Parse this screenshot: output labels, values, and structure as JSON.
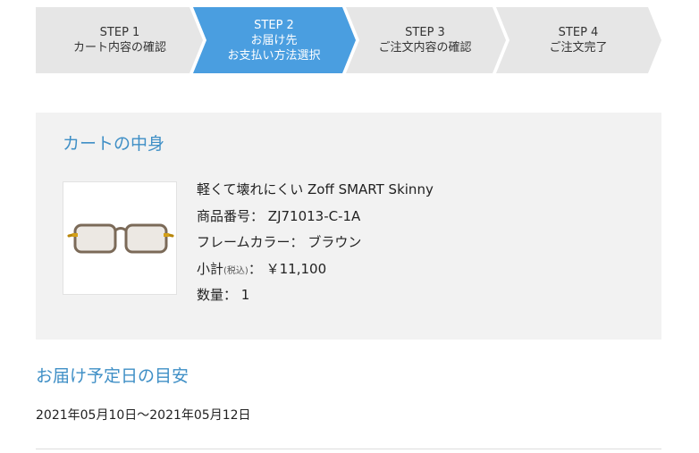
{
  "steps": [
    {
      "num": "STEP 1",
      "line1": "カート内容の確認",
      "line2": ""
    },
    {
      "num": "STEP 2",
      "line1": "お届け先",
      "line2": "お支払い方法選択"
    },
    {
      "num": "STEP 3",
      "line1": "ご注文内容の確認",
      "line2": ""
    },
    {
      "num": "STEP 4",
      "line1": "ご注文完了",
      "line2": ""
    }
  ],
  "colors": {
    "step_inactive": "#e6e6e6",
    "step_active": "#4a9ee0",
    "accent_title": "#3f8fc6",
    "panel_bg": "#f2f2f2"
  },
  "cart": {
    "title": "カートの中身",
    "product": {
      "image_icon": "eyeglasses-icon",
      "name": "軽くて壊れにくい Zoff SMART Skinny",
      "code_label": "商品番号：",
      "code_value": "ZJ71013-C-1A",
      "color_label": "フレームカラー：",
      "color_value": "ブラウン",
      "subtotal_label": "小計",
      "subtotal_tax": "(税込)",
      "subtotal_sep": "：",
      "subtotal_value": "￥11,100",
      "qty_label": "数量：",
      "qty_value": "1"
    }
  },
  "delivery": {
    "title": "お届け予定日の目安",
    "dates": "2021年05月10日～2021年05月12日"
  }
}
